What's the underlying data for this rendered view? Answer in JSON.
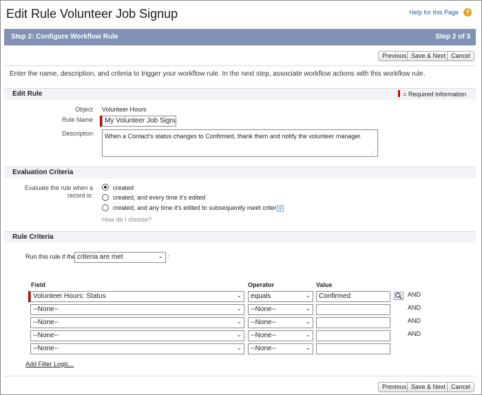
{
  "header": {
    "title": "Edit Rule Volunteer Job Signup",
    "help_link": "Help for this Page",
    "help_icon": "question-icon"
  },
  "step": {
    "label": "Step 2: Configure Workflow Rule",
    "count": "Step 2 of 3"
  },
  "buttons": {
    "previous": "Previous",
    "save_next": "Save & Next",
    "cancel": "Cancel"
  },
  "intro": "Enter the name, description, and criteria to trigger your workflow rule. In the next step, associate workflow actions with this workflow rule.",
  "edit_rule": {
    "heading": "Edit Rule",
    "required_legend": "= Required Information",
    "object_label": "Object",
    "object_value": "Volunteer Hours",
    "rule_name_label": "Rule Name",
    "rule_name_value": "My Volunteer Job Signu",
    "description_label": "Description",
    "description_value": "When a Contact's status changes to Confirmed, thank them and notify the volunteer manager."
  },
  "evaluation": {
    "heading": "Evaluation Criteria",
    "label_line1": "Evaluate the rule when a",
    "label_line2": "record is:",
    "options": [
      "created",
      "created, and every time it's edited",
      "created, and any time it's edited to subsequently meet criteria"
    ],
    "selected_index": 0,
    "how_link": "How do I choose?"
  },
  "criteria": {
    "heading": "Rule Criteria",
    "run_label": "Run this rule if the",
    "run_value": "criteria are met",
    "run_suffix": ":",
    "headers": {
      "field": "Field",
      "operator": "Operator",
      "value": "Value"
    },
    "rows": [
      {
        "field": "Volunteer Hours: Status",
        "operator": "equals",
        "value": "Confirmed",
        "conj": "AND"
      },
      {
        "field": "--None--",
        "operator": "--None--",
        "value": "",
        "conj": "AND"
      },
      {
        "field": "--None--",
        "operator": "--None--",
        "value": "",
        "conj": "AND"
      },
      {
        "field": "--None--",
        "operator": "--None--",
        "value": "",
        "conj": "AND"
      },
      {
        "field": "--None--",
        "operator": "--None--",
        "value": "",
        "conj": ""
      }
    ],
    "filter_logic_link": "Add Filter Logic...",
    "lookup_icon": "lookup-icon"
  },
  "colors": {
    "step_bar": "#8093b5",
    "required": "#cc0000",
    "help_icon": "#e6a21c",
    "link": "#1a5eab"
  }
}
